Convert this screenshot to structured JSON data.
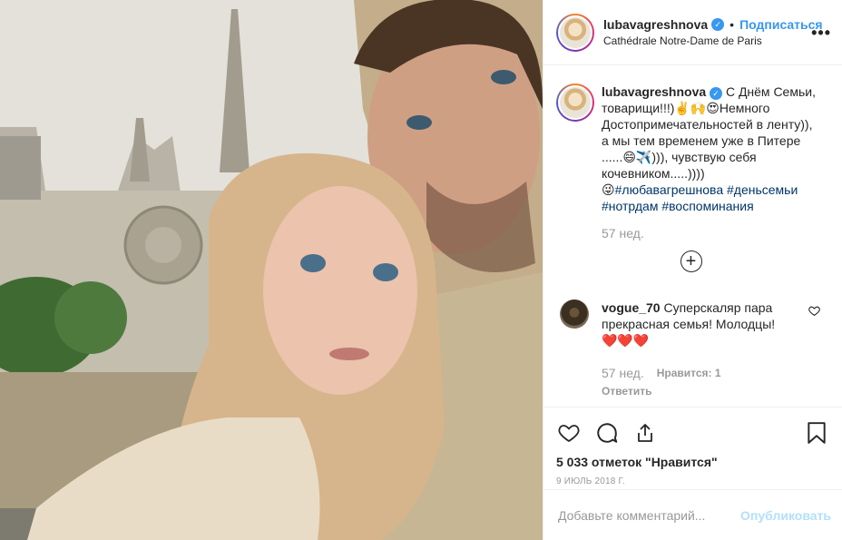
{
  "post": {
    "username": "lubavagreshnova",
    "verified_mark": "✓",
    "follow_label": "Подписаться",
    "location": "Cathédrale Notre-Dame de Paris",
    "more_label": "•••"
  },
  "caption": {
    "username": "lubavagreshnova",
    "text_main": "С Днём Семьи, товарищи!!!)✌️🙌😍Немного Достопримечательностей в ленту)), а мы тем временем уже в Питере ......😄✈️))), чувствую себя кочевником.....))))",
    "text_lead": "😜",
    "hashtags": [
      "#любавагрешнова",
      "#деньсемьи",
      "#нотрдам",
      "#воспоминания"
    ],
    "time": "57 нед.",
    "load_more": "+"
  },
  "comment": {
    "username": "vogue_70",
    "text": "Суперскаляр пара прекрасная семья! Молодцы!",
    "hearts": "❤️❤️❤️",
    "time": "57 нед.",
    "likes": "Нравится: 1",
    "reply": "Ответить"
  },
  "actions": {
    "likes_count": "5 033 отметок \"Нравится\"",
    "date": "9 июль 2018 г.",
    "icons": [
      "heart-icon",
      "comment-icon",
      "share-icon",
      "bookmark-icon"
    ]
  },
  "add_comment": {
    "placeholder": "Добавьте комментарий...",
    "publish_label": "Опубликовать"
  },
  "colors": {
    "link": "#3897f0",
    "hashtag": "#003569",
    "muted": "#999999",
    "publish_disabled": "#b2dffc",
    "heart": "#ed4956"
  }
}
